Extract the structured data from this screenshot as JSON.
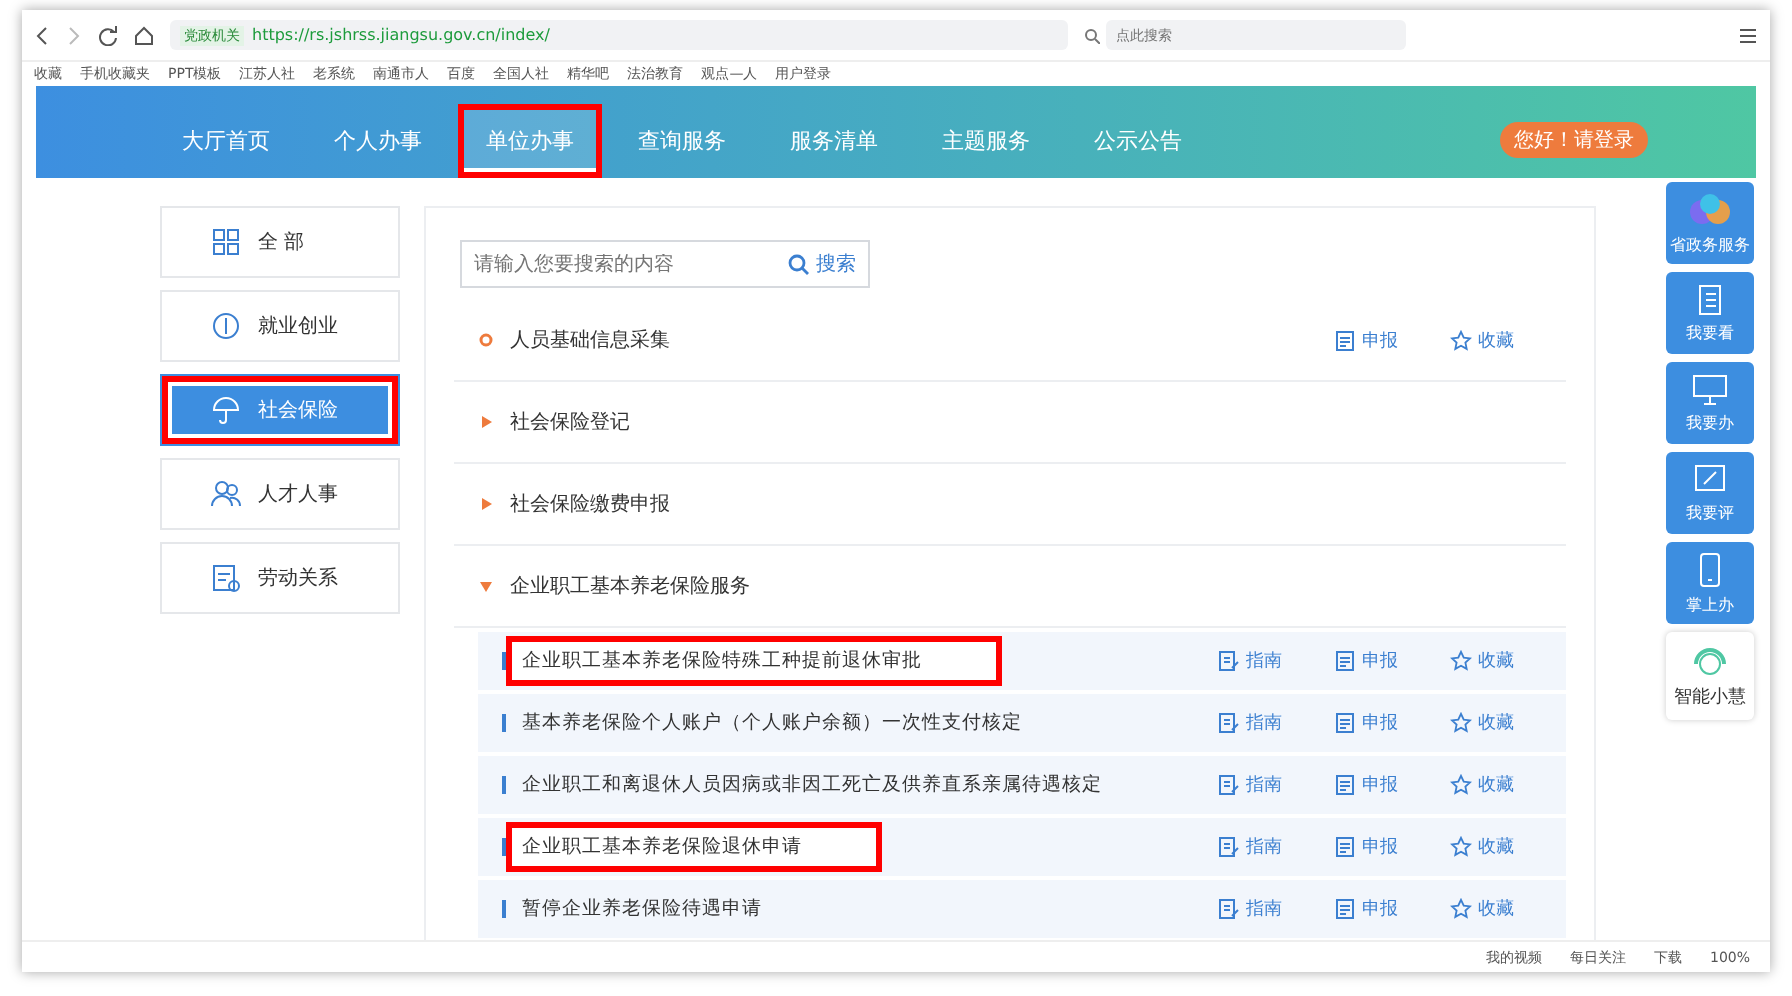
{
  "browser": {
    "security_label": "党政机关",
    "url": "https://rs.jshrss.jiangsu.gov.cn/index/",
    "search": {
      "placeholder": "点此搜索"
    },
    "bookmarks": [
      "收藏",
      "手机收藏夹",
      "PPT模板",
      "江苏人社",
      "老系统",
      "南通市人",
      "百度",
      "全国人社",
      "精华吧",
      "法治教育",
      "观点—人",
      "用户登录"
    ]
  },
  "nav": [
    {
      "label": "大厅首页",
      "selected": false,
      "highlighted": false
    },
    {
      "label": "个人办事",
      "selected": false,
      "highlighted": false
    },
    {
      "label": "单位办事",
      "selected": true,
      "highlighted": true
    },
    {
      "label": "查询服务",
      "selected": false,
      "highlighted": false
    },
    {
      "label": "服务清单",
      "selected": false,
      "highlighted": false
    },
    {
      "label": "主题服务",
      "selected": false,
      "highlighted": false
    },
    {
      "label": "公示公告",
      "selected": false,
      "highlighted": false
    }
  ],
  "login": "您好！请登录",
  "sidebar": [
    {
      "label": "全 部",
      "selected": false,
      "highlighted": false
    },
    {
      "label": "就业创业",
      "selected": false,
      "highlighted": false
    },
    {
      "label": "社会保险",
      "selected": true,
      "highlighted": true
    },
    {
      "label": "人才人事",
      "selected": false,
      "highlighted": false
    },
    {
      "label": "劳动关系",
      "selected": false,
      "highlighted": false
    }
  ],
  "search": {
    "placeholder": "请输入您要搜索的内容",
    "button": "搜索"
  },
  "categories": [
    {
      "kind": "leaf",
      "label": "人员基础信息采集",
      "actions": [
        "申报",
        "收藏"
      ]
    },
    {
      "kind": "group",
      "label": "社会保险登记",
      "expanded": false
    },
    {
      "kind": "group",
      "label": "社会保险缴费申报",
      "expanded": false
    },
    {
      "kind": "group",
      "label": "企业职工基本养老保险服务",
      "expanded": true,
      "children": [
        {
          "label": "企业职工基本养老保险特殊工种提前退休审批",
          "highlighted": true,
          "actions": [
            "指南",
            "申报",
            "收藏"
          ]
        },
        {
          "label": "基本养老保险个人账户（个人账户余额）一次性支付核定",
          "highlighted": false,
          "actions": [
            "指南",
            "申报",
            "收藏"
          ]
        },
        {
          "label": "企业职工和离退休人员因病或非因工死亡及供养直系亲属待遇核定",
          "highlighted": false,
          "actions": [
            "指南",
            "申报",
            "收藏"
          ]
        },
        {
          "label": "企业职工基本养老保险退休申请",
          "highlighted": true,
          "actions": [
            "指南",
            "申报",
            "收藏"
          ]
        },
        {
          "label": "暂停企业养老保险待遇申请",
          "highlighted": false,
          "actions": [
            "指南",
            "申报",
            "收藏"
          ]
        }
      ]
    }
  ],
  "float_menu": [
    {
      "kind": "logo",
      "label": "省政务服务"
    },
    {
      "kind": "book",
      "label": "我要看"
    },
    {
      "kind": "monitor",
      "label": "我要办"
    },
    {
      "kind": "pen",
      "label": "我要评"
    },
    {
      "kind": "phone",
      "label": "掌上办"
    },
    {
      "kind": "headset",
      "label": "智能小慧"
    }
  ],
  "status_bar": {
    "items": [
      "我的视频",
      "每日关注",
      "下载",
      "100%"
    ]
  }
}
